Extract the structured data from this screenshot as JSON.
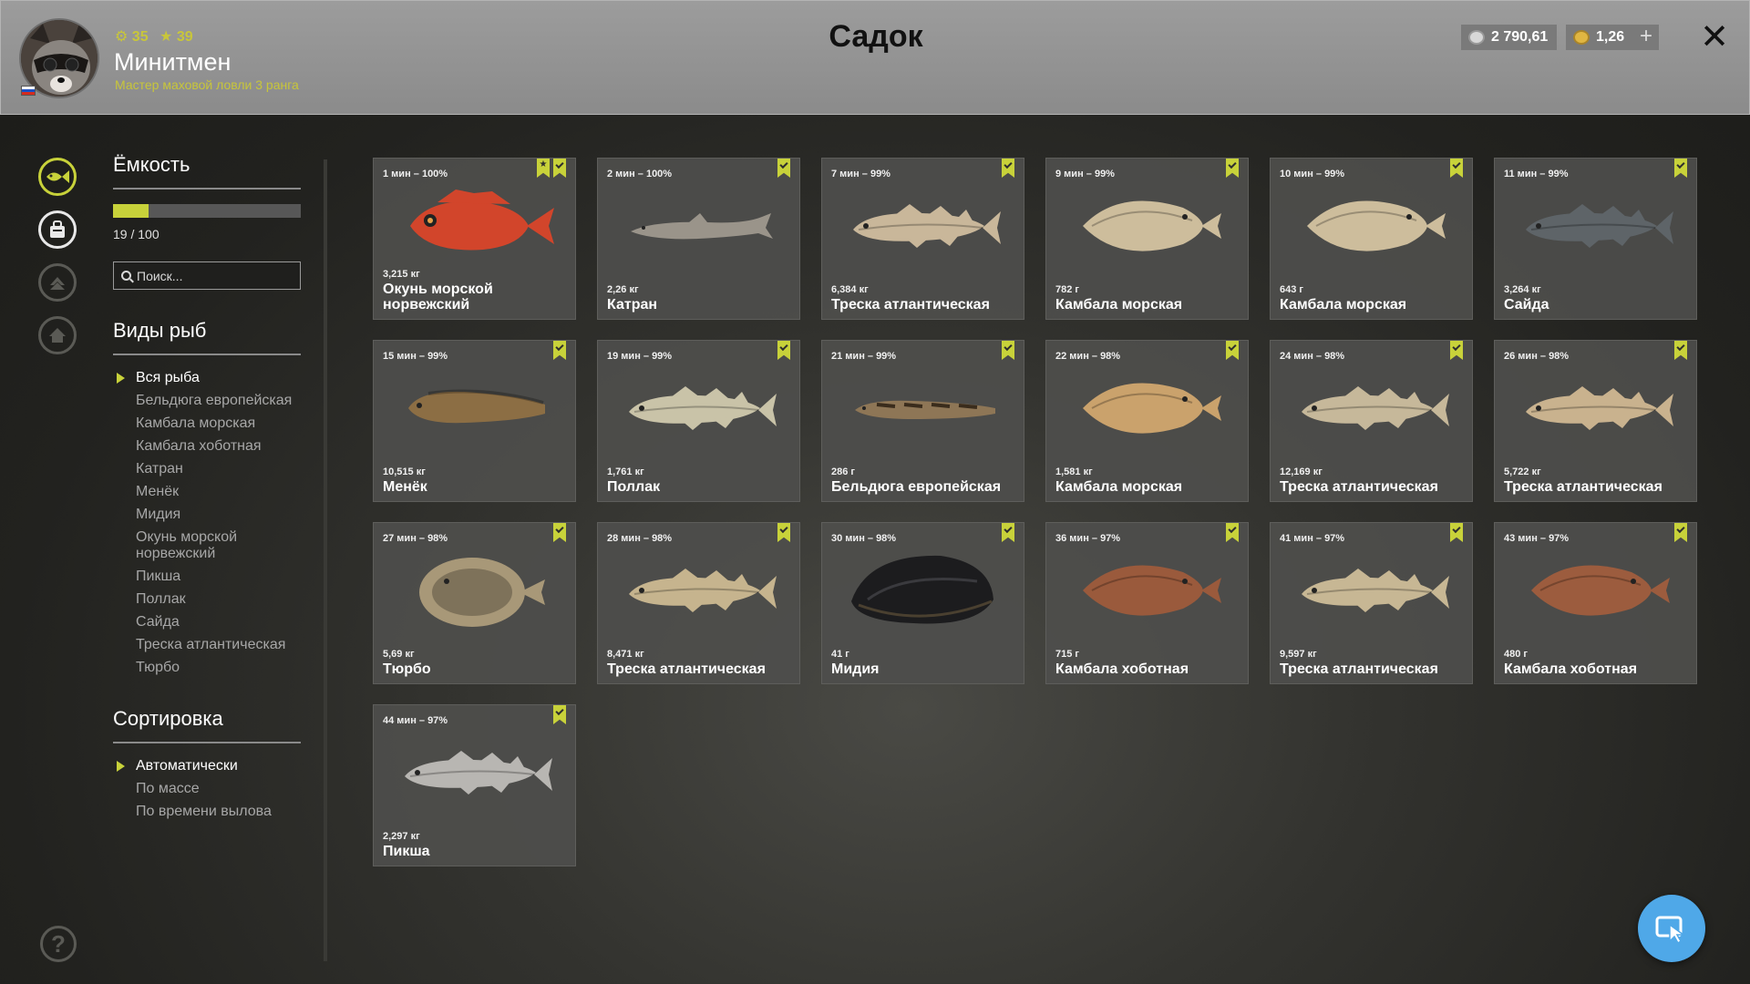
{
  "header": {
    "title": "Садок",
    "player": {
      "name": "Минитмен",
      "rank": "Мастер маховой ловли 3 ранга",
      "level": "35",
      "stars": "39"
    },
    "silver": "2 790,61",
    "gold": "1,26",
    "add_label": "+",
    "close_label": "✕"
  },
  "panel": {
    "capacity_title": "Ёмкость",
    "capacity_text": "19 / 100",
    "capacity_fraction": 0.19,
    "search_placeholder": "Поиск...",
    "species_title": "Виды рыб",
    "species": [
      "Вся рыба",
      "Бельдюга европейская",
      "Камбала морская",
      "Камбала хоботная",
      "Катран",
      "Менёк",
      "Мидия",
      "Окунь морской норвежский",
      "Пикша",
      "Поллак",
      "Сайда",
      "Треска атлантическая",
      "Тюрбо"
    ],
    "sort_title": "Сортировка",
    "sort_options": [
      "Автоматически",
      "По массе",
      "По времени вылова"
    ]
  },
  "help_label": "?",
  "fish": [
    {
      "meta": "1 мин – 100%",
      "weight": "3,215 кг",
      "name": "Окунь морской норвежский",
      "color": "#d2452b",
      "shape": "perch",
      "star": true
    },
    {
      "meta": "2 мин – 100%",
      "weight": "2,26 кг",
      "name": "Катран",
      "color": "#9a948a",
      "shape": "shark"
    },
    {
      "meta": "7 мин – 99%",
      "weight": "6,384 кг",
      "name": "Треска атлантическая",
      "color": "#c9b79a",
      "shape": "cod"
    },
    {
      "meta": "9 мин – 99%",
      "weight": "782 г",
      "name": "Камбала морская",
      "color": "#cdbd9c",
      "shape": "flat"
    },
    {
      "meta": "10 мин – 99%",
      "weight": "643 г",
      "name": "Камбала морская",
      "color": "#cdbd9c",
      "shape": "flat"
    },
    {
      "meta": "11 мин – 99%",
      "weight": "3,264 кг",
      "name": "Сайда",
      "color": "#5e6468",
      "shape": "cod"
    },
    {
      "meta": "15 мин – 99%",
      "weight": "10,515 кг",
      "name": "Менёк",
      "color": "#8c6e44",
      "shape": "eel"
    },
    {
      "meta": "19 мин – 99%",
      "weight": "1,761 кг",
      "name": "Поллак",
      "color": "#c9c3a8",
      "shape": "cod"
    },
    {
      "meta": "21 мин – 99%",
      "weight": "286 г",
      "name": "Бельдюга европейская",
      "color": "#8e7656",
      "shape": "thin"
    },
    {
      "meta": "22 мин – 98%",
      "weight": "1,581 кг",
      "name": "Камбала морская",
      "color": "#caa26c",
      "shape": "flat"
    },
    {
      "meta": "24 мин – 98%",
      "weight": "12,169 кг",
      "name": "Треска атлантическая",
      "color": "#c6b89a",
      "shape": "cod"
    },
    {
      "meta": "26 мин – 98%",
      "weight": "5,722 кг",
      "name": "Треска атлантическая",
      "color": "#c9b28e",
      "shape": "cod"
    },
    {
      "meta": "27 мин – 98%",
      "weight": "5,69 кг",
      "name": "Тюрбо",
      "color": "#a89878",
      "shape": "round"
    },
    {
      "meta": "28 мин – 98%",
      "weight": "8,471 кг",
      "name": "Треска атлантическая",
      "color": "#c6b48e",
      "shape": "cod"
    },
    {
      "meta": "30 мин – 98%",
      "weight": "41 г",
      "name": "Мидия",
      "color": "#1c1c1e",
      "shape": "mussel"
    },
    {
      "meta": "36 мин – 97%",
      "weight": "715 г",
      "name": "Камбала хоботная",
      "color": "#9a5a3c",
      "shape": "flat"
    },
    {
      "meta": "41 мин – 97%",
      "weight": "9,597 кг",
      "name": "Треска атлантическая",
      "color": "#c7b794",
      "shape": "cod"
    },
    {
      "meta": "43 мин – 97%",
      "weight": "480 г",
      "name": "Камбала хоботная",
      "color": "#9c5c3e",
      "shape": "flat"
    },
    {
      "meta": "44 мин – 97%",
      "weight": "2,297 кг",
      "name": "Пикша",
      "color": "#b8b6b2",
      "shape": "cod"
    }
  ]
}
